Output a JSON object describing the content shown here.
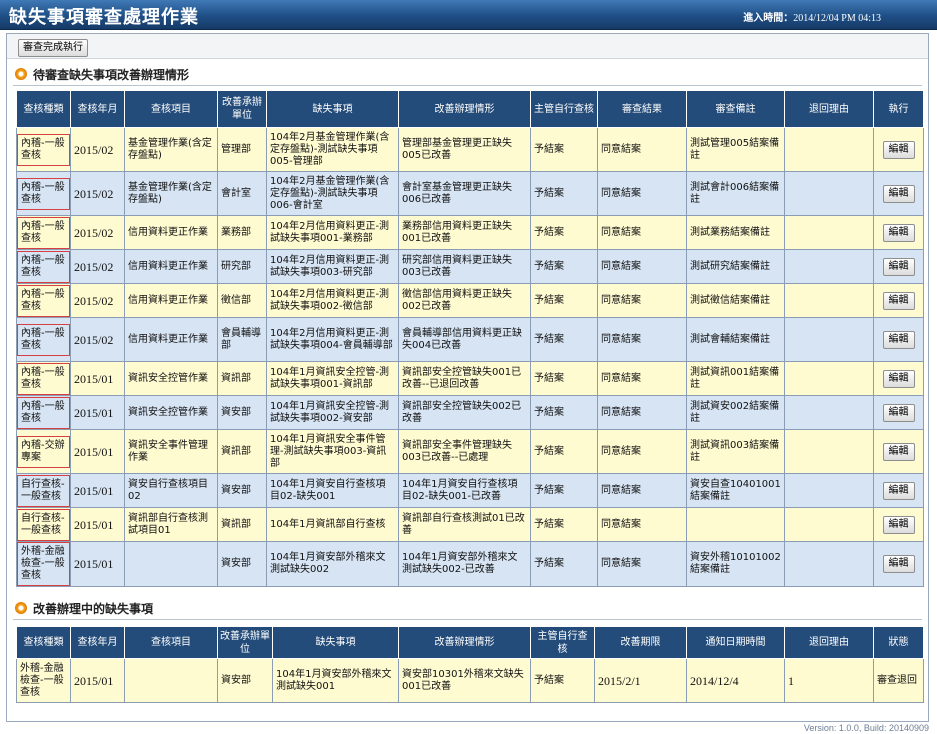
{
  "header": {
    "title": "缺失事項審查處理作業",
    "login_label": "進入時間：",
    "login_time": "2014/12/04 PM 04:13"
  },
  "toolbar": {
    "complete_button": "審查完成執行"
  },
  "section1": {
    "title": "待審查缺失事項改善辦理情形",
    "columns": [
      "查核種類",
      "查核年月",
      "查核項目",
      "改善承辦單位",
      "缺失事項",
      "改善辦理情形",
      "主管自行查核",
      "審查結果",
      "審查備註",
      "退回理由",
      "執行"
    ],
    "edit_label": "編輯",
    "rows": [
      {
        "cat": "內稽-一般查核",
        "ym": "2015/02",
        "item": "基金管理作業(含定存盤點)",
        "unit": "管理部",
        "defect": "104年2月基金管理作業(含定存盤點)-測試缺失事項005-管理部",
        "status": "管理部基金管理更正缺失005已改善",
        "self": "予結案",
        "result": "同意結案",
        "note": "測試管理005結案備註",
        "reason": ""
      },
      {
        "cat": "內稽-一般查核",
        "ym": "2015/02",
        "item": "基金管理作業(含定存盤點)",
        "unit": "會計室",
        "defect": "104年2月基金管理作業(含定存盤點)-測試缺失事項006-會計室",
        "status": "會計室基金管理更正缺失006已改善",
        "self": "予結案",
        "result": "同意結案",
        "note": "測試會計006結案備註",
        "reason": ""
      },
      {
        "cat": "內稽-一般查核",
        "ym": "2015/02",
        "item": "信用資料更正作業",
        "unit": "業務部",
        "defect": "104年2月信用資料更正-測試缺失事項001-業務部",
        "status": "業務部信用資料更正缺失001已改善",
        "self": "予結案",
        "result": "同意結案",
        "note": "測試業務結案備註",
        "reason": ""
      },
      {
        "cat": "內稽-一般查核",
        "ym": "2015/02",
        "item": "信用資料更正作業",
        "unit": "研究部",
        "defect": "104年2月信用資料更正-測試缺失事項003-研究部",
        "status": "研究部信用資料更正缺失003已改善",
        "self": "予結案",
        "result": "同意結案",
        "note": "測試研究結案備註",
        "reason": ""
      },
      {
        "cat": "內稽-一般查核",
        "ym": "2015/02",
        "item": "信用資料更正作業",
        "unit": "徵信部",
        "defect": "104年2月信用資料更正-測試缺失事項002-徵信部",
        "status": "徵信部信用資料更正缺失002已改善",
        "self": "予結案",
        "result": "同意結案",
        "note": "測試徵信結案備註",
        "reason": ""
      },
      {
        "cat": "內稽-一般查核",
        "ym": "2015/02",
        "item": "信用資料更正作業",
        "unit": "會員輔導部",
        "defect": "104年2月信用資料更正-測試缺失事項004-會員輔導部",
        "status": "會員輔導部信用資料更正缺失004已改善",
        "self": "予結案",
        "result": "同意結案",
        "note": "測試會輔結案備註",
        "reason": ""
      },
      {
        "cat": "內稽-一般查核",
        "ym": "2015/01",
        "item": "資訊安全控管作業",
        "unit": "資訊部",
        "defect": "104年1月資訊安全控管-測試缺失事項001-資訊部",
        "status": "資訊部安全控管缺失001已改善--已退回改善",
        "self": "予結案",
        "result": "同意結案",
        "note": "測試資訊001結案備註",
        "reason": ""
      },
      {
        "cat": "內稽-一般查核",
        "ym": "2015/01",
        "item": "資訊安全控管作業",
        "unit": "資安部",
        "defect": "104年1月資訊安全控管-測試缺失事項002-資安部",
        "status": "資訊部安全控管缺失002已改善",
        "self": "予結案",
        "result": "同意結案",
        "note": "測試資安002結案備註",
        "reason": ""
      },
      {
        "cat": "內稽-交辦專案",
        "ym": "2015/01",
        "item": "資訊安全事件管理作業",
        "unit": "資訊部",
        "defect": "104年1月資訊安全事件管理-測試缺失事項003-資訊部",
        "status": "資訊部安全事件管理缺失003已改善--已處理",
        "self": "予結案",
        "result": "同意結案",
        "note": "測試資訊003結案備註",
        "reason": ""
      },
      {
        "cat": "自行查核-一般查核",
        "ym": "2015/01",
        "item": "資安自行查核項目02",
        "unit": "資安部",
        "defect": "104年1月資安自行查核項目02-缺失001",
        "status": "104年1月資安自行查核項目02-缺失001-已改善",
        "self": "予結案",
        "result": "同意結案",
        "note": "資安自查10401001結案備註",
        "reason": ""
      },
      {
        "cat": "自行查核-一般查核",
        "ym": "2015/01",
        "item": "資訊部自行查核測試項目01",
        "unit": "資訊部",
        "defect": "104年1月資訊部自行查核",
        "status": "資訊部自行查核測試01已改善",
        "self": "予結案",
        "result": "同意結案",
        "note": "",
        "reason": ""
      },
      {
        "cat": "外稽-金融檢查-一般查核",
        "ym": "2015/01",
        "item": "",
        "unit": "資安部",
        "defect": "104年1月資安部外稽來文測試缺失002",
        "status": "104年1月資安部外稽來文測試缺失002-已改善",
        "self": "予結案",
        "result": "同意結案",
        "note": "資安外稽10101002結案備註",
        "reason": ""
      }
    ]
  },
  "section2": {
    "title": "改善辦理中的缺失事項",
    "columns": [
      "查核種類",
      "查核年月",
      "查核項目",
      "改善承辦單位",
      "缺失事項",
      "改善辦理情形",
      "主管自行查核",
      "改善期限",
      "通知日期時間",
      "退回理由",
      "狀態"
    ],
    "rows": [
      {
        "cat": "外稽-金融檢查-一般查核",
        "ym": "2015/01",
        "item": "",
        "unit": "資安部",
        "defect": "104年1月資安部外稽來文測試缺失001",
        "status": "資安部10301外稽來文缺失001已改善",
        "self": "予結案",
        "deadline": "2015/2/1",
        "notify": "2014/12/4",
        "reason": "1",
        "state": "審查退回"
      }
    ]
  },
  "footer": {
    "version": "Version: 1.0.0, Build: 20140909"
  }
}
